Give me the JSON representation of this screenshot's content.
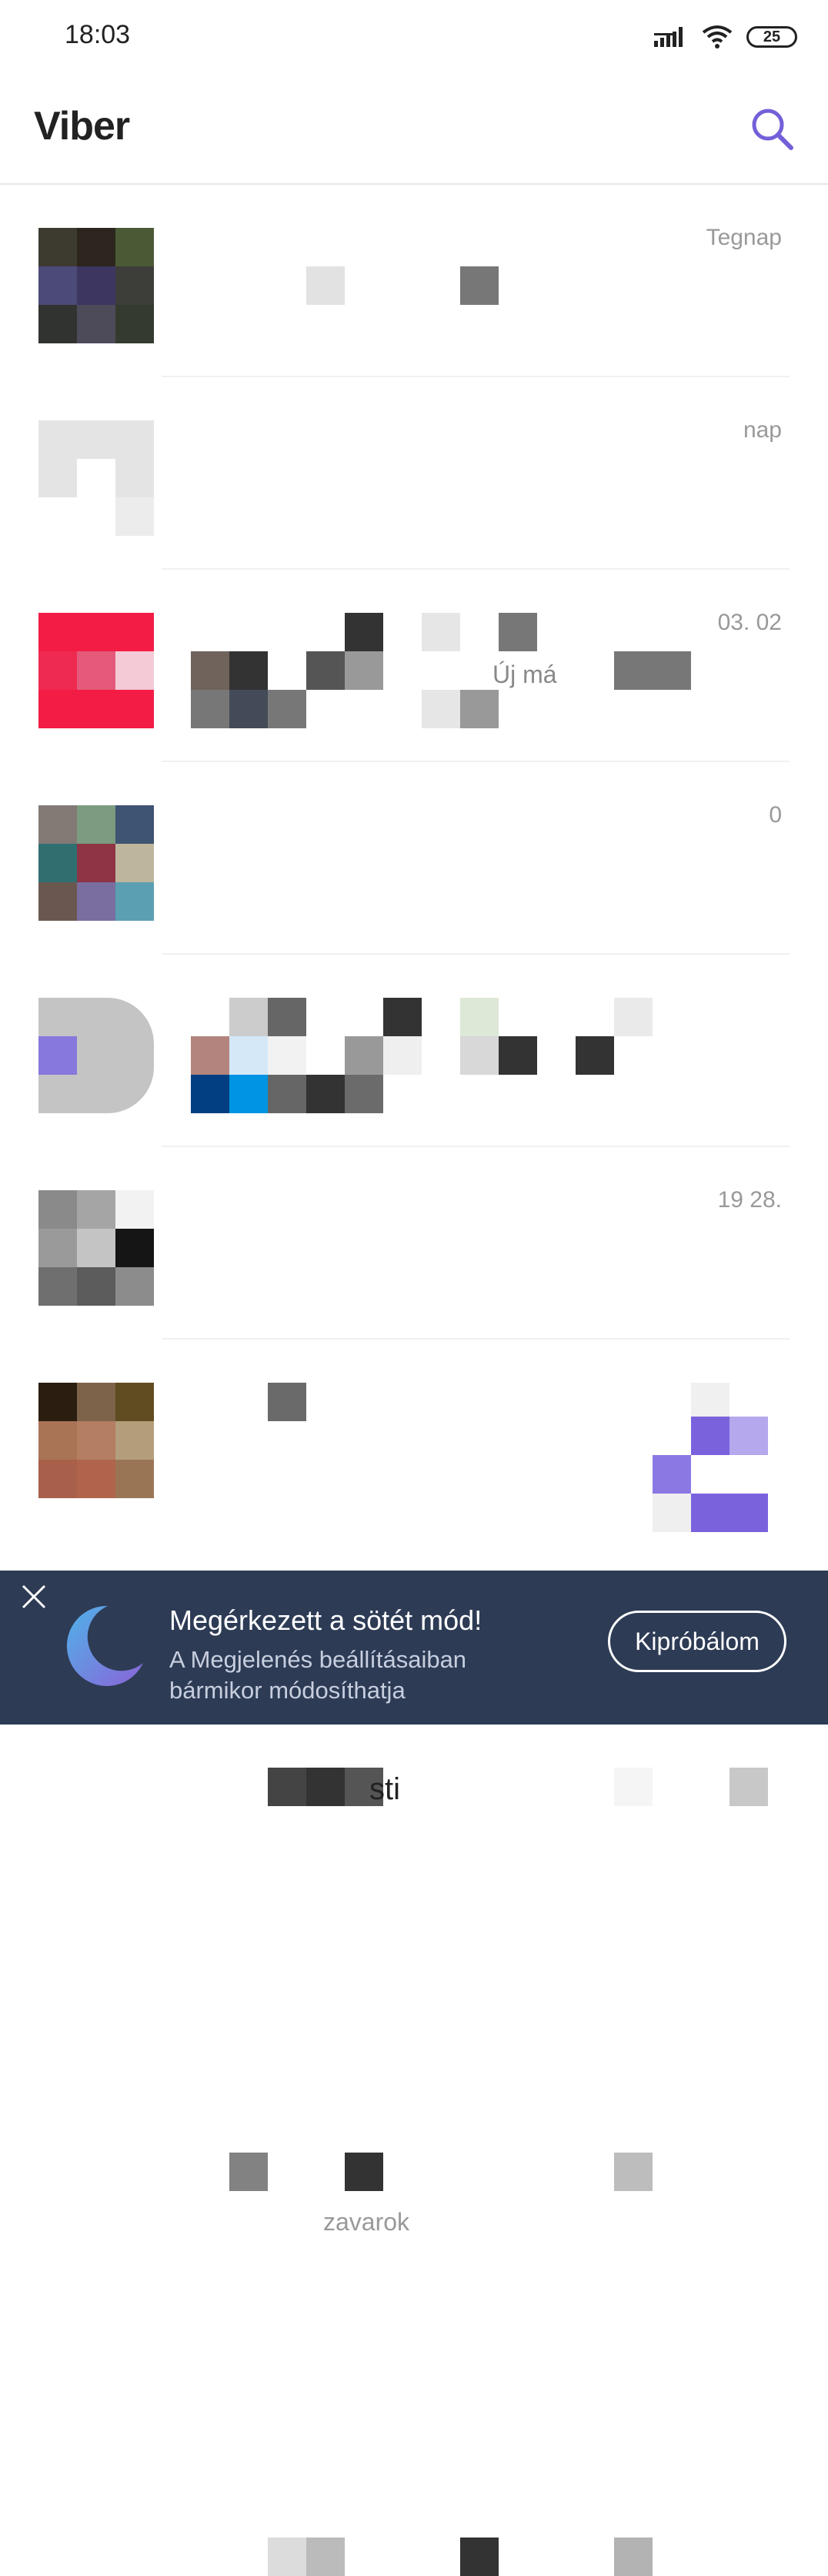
{
  "status_bar": {
    "time": "18:03",
    "battery": "25"
  },
  "header": {
    "title": "Viber",
    "search_icon": "search-icon"
  },
  "chats": [
    {
      "date": "Tegnap",
      "snippet": "",
      "avatar": [
        "#3d3a30",
        "#2c261f",
        "#4a5a35",
        "#4b4a78",
        "#3c3660",
        "#3d3d3a",
        "#30332f",
        "#4d4b5a",
        "#343a2e"
      ]
    },
    {
      "date": "nap",
      "snippet": "Új má",
      "avatar": [
        "#e4e4e4",
        "#ffffff",
        "#e4e4e4",
        "#e4e4e4",
        "#ffffff",
        "#e4e4e4",
        "#ffffff",
        "#ffffff",
        "#ececec"
      ]
    },
    {
      "date": "03. 02",
      "snippet": "",
      "avatar": [
        "#f21c45",
        "#f21c45",
        "#f21c45",
        "#ef2a51",
        "#e55a7a",
        "#f3cad6",
        "#f21c45",
        "#f21c45",
        "#f21c45"
      ]
    },
    {
      "date": "0",
      "snippet": "",
      "avatar": [
        "#837a76",
        "#7b9c80",
        "#3f5372",
        "#2f6f70",
        "#8e3445",
        "#bdb59c",
        "#6a5850",
        "#7a6ea0",
        "#5b9fb2"
      ]
    },
    {
      "date": "",
      "snippet": "sti",
      "avatar": [
        "#c4c4c4",
        "#c4c4c4",
        "#c4c4c4",
        "#8678dc",
        "#c4c4c4",
        "#c4c4c4",
        "#c4c4c4",
        "#c4c4c4",
        "#c4c4c4"
      ]
    },
    {
      "date": "19  28.",
      "snippet": "zavarok",
      "avatar": [
        "#8a8a8a",
        "#a5a5a5",
        "#f2f2f2",
        "#9a9a9a",
        "#c4c4c4",
        "#151515",
        "#6f6f6f",
        "#5c5c5c",
        "#8c8c8c"
      ]
    },
    {
      "date": "",
      "snippet": "",
      "avatar": [
        "#2b1e10",
        "#7d634a",
        "#5f4c20",
        "#a97356",
        "#b37e61",
        "#b39e7c",
        "#a9604a",
        "#b0644b",
        "#9a7555"
      ]
    }
  ],
  "banner": {
    "title": "Megérkezett a sötét mód!",
    "subtitle": "A Megjelenés beállításaiban bármikor módosíthatja",
    "button": "Kipróbálom"
  }
}
